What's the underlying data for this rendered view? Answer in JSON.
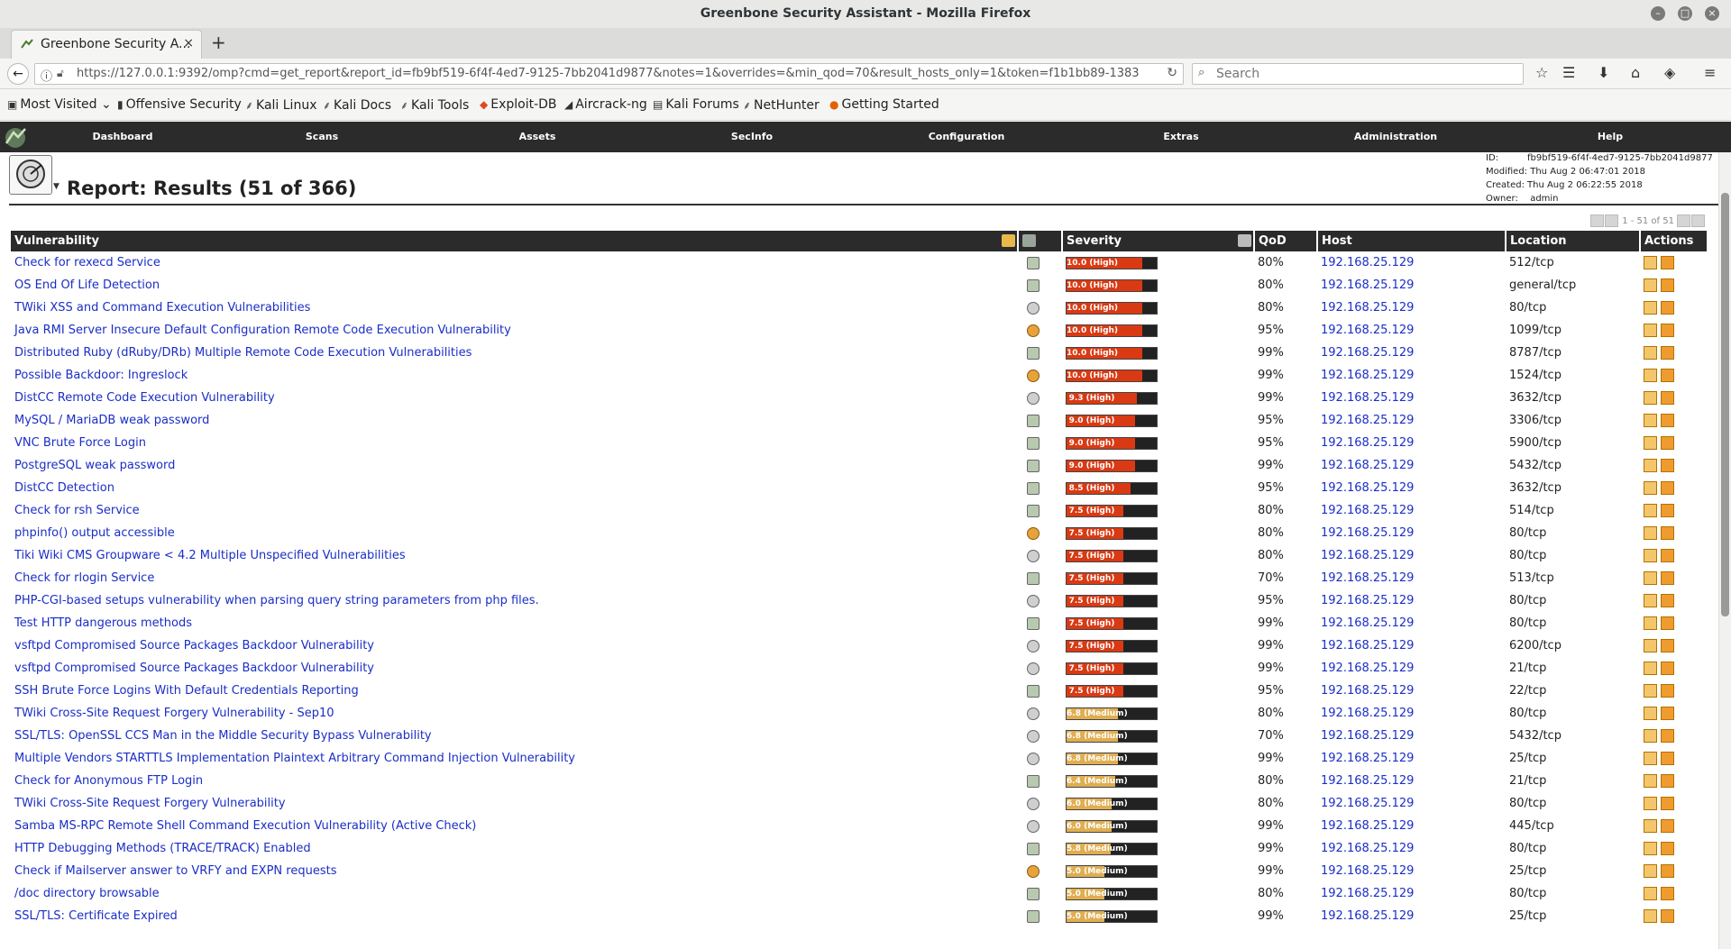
{
  "window": {
    "title": "Greenbone Security Assistant - Mozilla Firefox"
  },
  "tab": {
    "title": "Greenbone Security A..."
  },
  "url": "https://127.0.0.1:9392/omp?cmd=get_report&report_id=fb9bf519-6f4f-4ed7-9125-7bb2041d9877&notes=1&overrides=&min_qod=70&result_hosts_only=1&token=f1b1bb89-1383",
  "search_placeholder": "Search",
  "bookmarks": [
    "Most Visited",
    "Offensive Security",
    "Kali Linux",
    "Kali Docs",
    "Kali Tools",
    "Exploit-DB",
    "Aircrack-ng",
    "Kali Forums",
    "NetHunter",
    "Getting Started"
  ],
  "menu": [
    "Dashboard",
    "Scans",
    "Assets",
    "SecInfo",
    "Configuration",
    "Extras",
    "Administration",
    "Help"
  ],
  "page": {
    "title": "Report: Results (51 of 366)",
    "meta": {
      "id_label": "ID:",
      "id": "fb9bf519-6f4f-4ed7-9125-7bb2041d9877",
      "modified_label": "Modified:",
      "modified": "Thu Aug 2 06:47:01 2018",
      "created_label": "Created:",
      "created": "Thu Aug 2 06:22:55 2018",
      "owner_label": "Owner:",
      "owner": "admin"
    },
    "pager": "1 - 51 of 51"
  },
  "columns": [
    "Vulnerability",
    "",
    "Severity",
    "QoD",
    "Host",
    "Location",
    "Actions"
  ],
  "colors": {
    "high": "#d93a13",
    "medium": "#e0ae51",
    "link": "#1a2ec7",
    "menubar": "#2b2b2b"
  },
  "rows": [
    {
      "vuln": "Check for rexecd Service",
      "sol": "sq",
      "sev": 10.0,
      "level": "High",
      "qod": "80%",
      "host": "192.168.25.129",
      "loc": "512/tcp"
    },
    {
      "vuln": "OS End Of Life Detection",
      "sol": "sq",
      "sev": 10.0,
      "level": "High",
      "qod": "80%",
      "host": "192.168.25.129",
      "loc": "general/tcp"
    },
    {
      "vuln": "TWiki XSS and Command Execution Vulnerabilities",
      "sol": "c",
      "sev": 10.0,
      "level": "High",
      "qod": "80%",
      "host": "192.168.25.129",
      "loc": "80/tcp"
    },
    {
      "vuln": "Java RMI Server Insecure Default Configuration Remote Code Execution Vulnerability",
      "sol": "or",
      "sev": 10.0,
      "level": "High",
      "qod": "95%",
      "host": "192.168.25.129",
      "loc": "1099/tcp"
    },
    {
      "vuln": "Distributed Ruby (dRuby/DRb) Multiple Remote Code Execution Vulnerabilities",
      "sol": "sq",
      "sev": 10.0,
      "level": "High",
      "qod": "99%",
      "host": "192.168.25.129",
      "loc": "8787/tcp"
    },
    {
      "vuln": "Possible Backdoor: Ingreslock",
      "sol": "or",
      "sev": 10.0,
      "level": "High",
      "qod": "99%",
      "host": "192.168.25.129",
      "loc": "1524/tcp"
    },
    {
      "vuln": "DistCC Remote Code Execution Vulnerability",
      "sol": "c",
      "sev": 9.3,
      "level": "High",
      "qod": "99%",
      "host": "192.168.25.129",
      "loc": "3632/tcp"
    },
    {
      "vuln": "MySQL / MariaDB weak password",
      "sol": "sq",
      "sev": 9.0,
      "level": "High",
      "qod": "95%",
      "host": "192.168.25.129",
      "loc": "3306/tcp"
    },
    {
      "vuln": "VNC Brute Force Login",
      "sol": "sq",
      "sev": 9.0,
      "level": "High",
      "qod": "95%",
      "host": "192.168.25.129",
      "loc": "5900/tcp"
    },
    {
      "vuln": "PostgreSQL weak password",
      "sol": "sq",
      "sev": 9.0,
      "level": "High",
      "qod": "99%",
      "host": "192.168.25.129",
      "loc": "5432/tcp"
    },
    {
      "vuln": "DistCC Detection",
      "sol": "sq",
      "sev": 8.5,
      "level": "High",
      "qod": "95%",
      "host": "192.168.25.129",
      "loc": "3632/tcp"
    },
    {
      "vuln": "Check for rsh Service",
      "sol": "sq",
      "sev": 7.5,
      "level": "High",
      "qod": "80%",
      "host": "192.168.25.129",
      "loc": "514/tcp"
    },
    {
      "vuln": "phpinfo() output accessible",
      "sol": "or",
      "sev": 7.5,
      "level": "High",
      "qod": "80%",
      "host": "192.168.25.129",
      "loc": "80/tcp"
    },
    {
      "vuln": "Tiki Wiki CMS Groupware < 4.2 Multiple Unspecified Vulnerabilities",
      "sol": "c",
      "sev": 7.5,
      "level": "High",
      "qod": "80%",
      "host": "192.168.25.129",
      "loc": "80/tcp"
    },
    {
      "vuln": "Check for rlogin Service",
      "sol": "sq",
      "sev": 7.5,
      "level": "High",
      "qod": "70%",
      "host": "192.168.25.129",
      "loc": "513/tcp"
    },
    {
      "vuln": "PHP-CGI-based setups vulnerability when parsing query string parameters from php files.",
      "sol": "c",
      "sev": 7.5,
      "level": "High",
      "qod": "95%",
      "host": "192.168.25.129",
      "loc": "80/tcp"
    },
    {
      "vuln": "Test HTTP dangerous methods",
      "sol": "sq",
      "sev": 7.5,
      "level": "High",
      "qod": "99%",
      "host": "192.168.25.129",
      "loc": "80/tcp"
    },
    {
      "vuln": "vsftpd Compromised Source Packages Backdoor Vulnerability",
      "sol": "c",
      "sev": 7.5,
      "level": "High",
      "qod": "99%",
      "host": "192.168.25.129",
      "loc": "6200/tcp"
    },
    {
      "vuln": "vsftpd Compromised Source Packages Backdoor Vulnerability",
      "sol": "c",
      "sev": 7.5,
      "level": "High",
      "qod": "99%",
      "host": "192.168.25.129",
      "loc": "21/tcp"
    },
    {
      "vuln": "SSH Brute Force Logins With Default Credentials Reporting",
      "sol": "sq",
      "sev": 7.5,
      "level": "High",
      "qod": "95%",
      "host": "192.168.25.129",
      "loc": "22/tcp"
    },
    {
      "vuln": "TWiki Cross-Site Request Forgery Vulnerability - Sep10",
      "sol": "c",
      "sev": 6.8,
      "level": "Medium",
      "qod": "80%",
      "host": "192.168.25.129",
      "loc": "80/tcp"
    },
    {
      "vuln": "SSL/TLS: OpenSSL CCS Man in the Middle Security Bypass Vulnerability",
      "sol": "c",
      "sev": 6.8,
      "level": "Medium",
      "qod": "70%",
      "host": "192.168.25.129",
      "loc": "5432/tcp"
    },
    {
      "vuln": "Multiple Vendors STARTTLS Implementation Plaintext Arbitrary Command Injection Vulnerability",
      "sol": "c",
      "sev": 6.8,
      "level": "Medium",
      "qod": "99%",
      "host": "192.168.25.129",
      "loc": "25/tcp"
    },
    {
      "vuln": "Check for Anonymous FTP Login",
      "sol": "sq",
      "sev": 6.4,
      "level": "Medium",
      "qod": "80%",
      "host": "192.168.25.129",
      "loc": "21/tcp"
    },
    {
      "vuln": "TWiki Cross-Site Request Forgery Vulnerability",
      "sol": "c",
      "sev": 6.0,
      "level": "Medium",
      "qod": "80%",
      "host": "192.168.25.129",
      "loc": "80/tcp"
    },
    {
      "vuln": "Samba MS-RPC Remote Shell Command Execution Vulnerability (Active Check)",
      "sol": "c",
      "sev": 6.0,
      "level": "Medium",
      "qod": "99%",
      "host": "192.168.25.129",
      "loc": "445/tcp"
    },
    {
      "vuln": "HTTP Debugging Methods (TRACE/TRACK) Enabled",
      "sol": "sq",
      "sev": 5.8,
      "level": "Medium",
      "qod": "99%",
      "host": "192.168.25.129",
      "loc": "80/tcp"
    },
    {
      "vuln": "Check if Mailserver answer to VRFY and EXPN requests",
      "sol": "or",
      "sev": 5.0,
      "level": "Medium",
      "qod": "99%",
      "host": "192.168.25.129",
      "loc": "25/tcp"
    },
    {
      "vuln": "/doc directory browsable",
      "sol": "sq",
      "sev": 5.0,
      "level": "Medium",
      "qod": "80%",
      "host": "192.168.25.129",
      "loc": "80/tcp"
    },
    {
      "vuln": "SSL/TLS: Certificate Expired",
      "sol": "sq",
      "sev": 5.0,
      "level": "Medium",
      "qod": "99%",
      "host": "192.168.25.129",
      "loc": "25/tcp"
    }
  ]
}
